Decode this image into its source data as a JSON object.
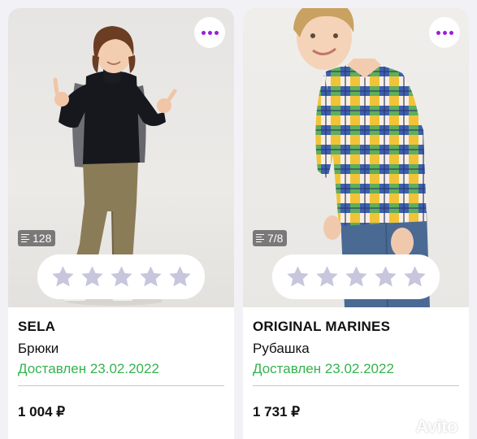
{
  "cards": [
    {
      "brand": "SELA",
      "product_type": "Брюки",
      "status": "Доставлен 23.02.2022",
      "price": "1 004 ₽",
      "photo_count": "128",
      "rating_stars": 0,
      "rating_max": 5
    },
    {
      "brand": "ORIGINAL MARINES",
      "product_type": "Рубашка",
      "status": "Доставлен 23.02.2022",
      "price": "1 731 ₽",
      "photo_count": "7/8",
      "rating_stars": 0,
      "rating_max": 5
    }
  ],
  "icons": {
    "more": "more-dots-icon",
    "photos": "gallery-list-icon",
    "star": "star-icon"
  },
  "colors": {
    "accent": "#9b1fd6",
    "status_green": "#35b34e",
    "star_empty": "#c8c6dc"
  },
  "watermark": {
    "text": "Avito"
  }
}
